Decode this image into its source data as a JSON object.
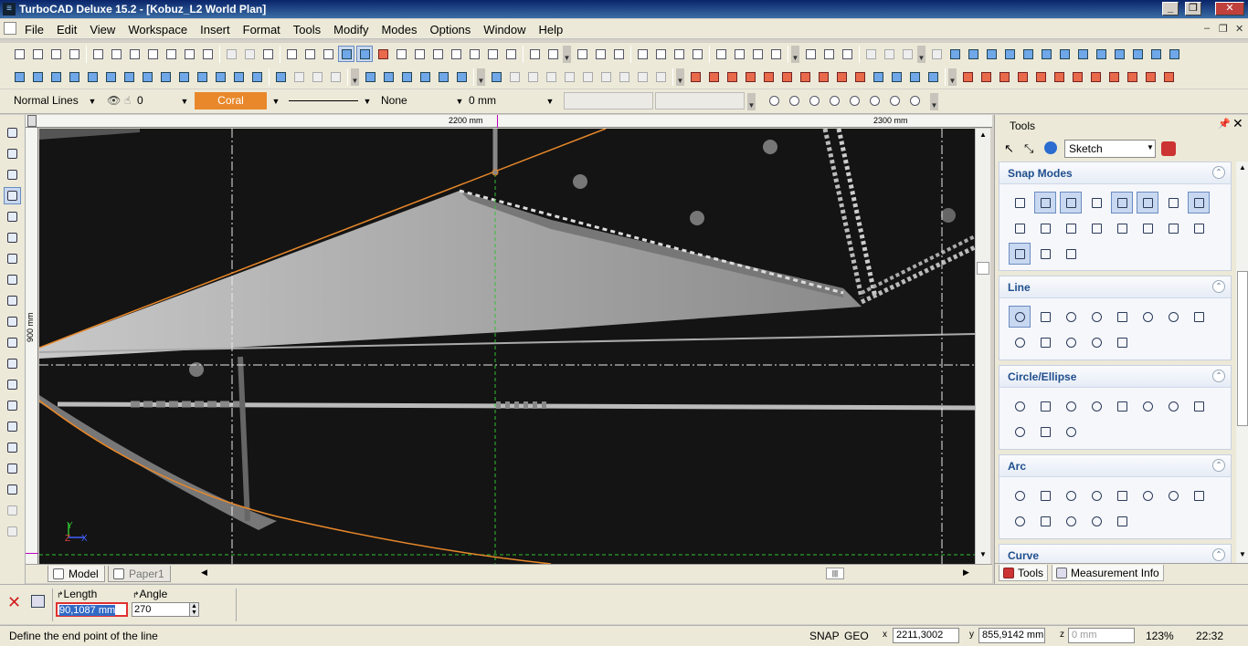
{
  "window": {
    "title": "TurboCAD Deluxe 15.2 - [Kobuz_L2 World Plan]"
  },
  "menu": [
    "File",
    "Edit",
    "View",
    "Workspace",
    "Insert",
    "Format",
    "Tools",
    "Modify",
    "Modes",
    "Options",
    "Window",
    "Help"
  ],
  "property_bar": {
    "layer": "Normal Lines",
    "layer_count": "0",
    "color": "Coral",
    "color_hex": "#e8882a",
    "pattern": "None",
    "width": "0 mm"
  },
  "ruler": {
    "h_labels": [
      "2200 mm",
      "2300 mm"
    ],
    "v_labels": [
      "900 mm"
    ]
  },
  "canvas": {
    "axis_x": "X",
    "axis_y": "Y",
    "axis_z": "Z",
    "line_color": "#e8882a"
  },
  "tabs": [
    "Model",
    "Paper1"
  ],
  "input": {
    "length_label": "Length",
    "length_value": "90,1087 mm",
    "angle_label": "Angle",
    "angle_value": "270"
  },
  "status": {
    "message": "Define the end point of the line",
    "snap": "SNAP",
    "geo": "GEO",
    "x": "2211,3002 mm",
    "y": "855,9142 mm",
    "z_placeholder": "0 mm",
    "zoom": "123%",
    "time": "22:32"
  },
  "tools_panel": {
    "title": "Tools",
    "mode": "Sketch",
    "groups": [
      "Snap Modes",
      "Line",
      "Circle/Ellipse",
      "Arc",
      "Curve"
    ],
    "tabs": [
      "Tools",
      "Measurement Info"
    ]
  }
}
